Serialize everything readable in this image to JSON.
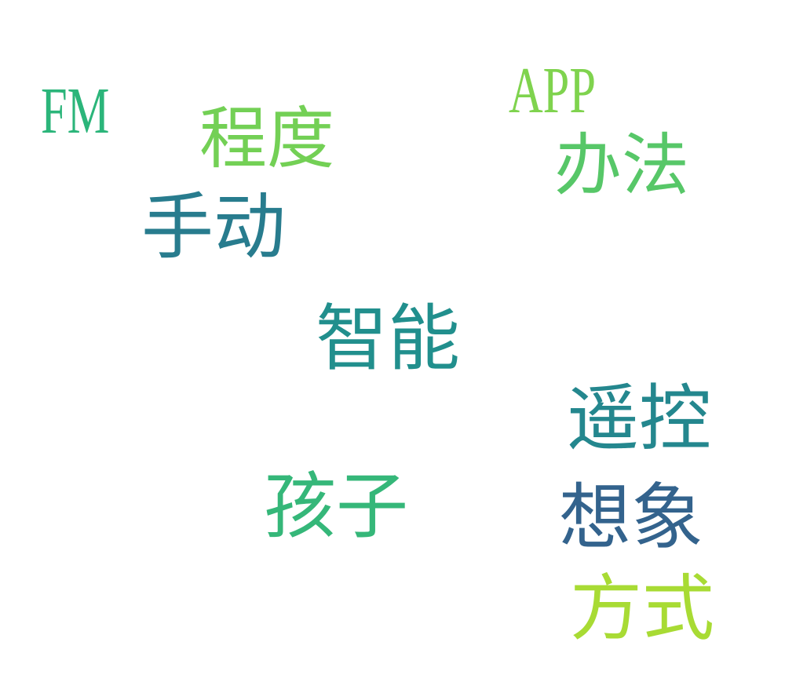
{
  "words": {
    "fm": {
      "text": "FM",
      "color": "#2bb57a"
    },
    "app": {
      "text": "APP",
      "color": "#7fd34e"
    },
    "chengdu": {
      "text": "程度",
      "color": "#73d055"
    },
    "banfa": {
      "text": "办法",
      "color": "#57c768"
    },
    "shoudong": {
      "text": "手动",
      "color": "#287c8e"
    },
    "zhineng": {
      "text": "智能",
      "color": "#218f8d"
    },
    "yaokong": {
      "text": "遥控",
      "color": "#24878e"
    },
    "haizi": {
      "text": "孩子",
      "color": "#35b779"
    },
    "xiangxiang": {
      "text": "想象",
      "color": "#33638d"
    },
    "fangshi": {
      "text": "方式",
      "color": "#a8db34"
    }
  }
}
